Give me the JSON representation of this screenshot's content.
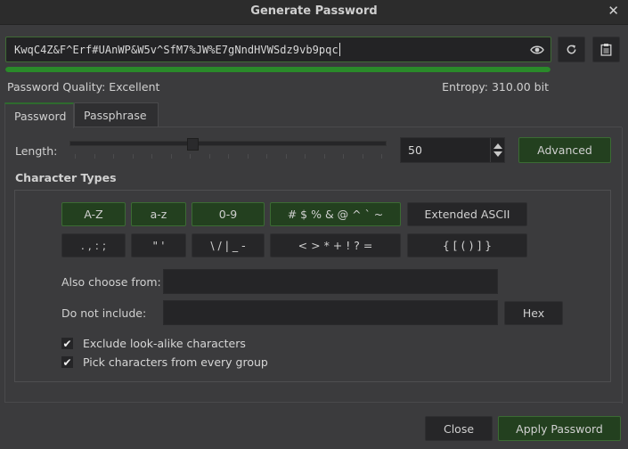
{
  "window": {
    "title": "Generate Password",
    "close_glyph": "✕"
  },
  "password": {
    "value": "KwqC4Z&F^Erf#UAnWP&W5v^SfM7%JW%E7gNndHVWSdz9vb9pqc",
    "visibility_icon": "eye-icon",
    "regenerate_icon": "refresh-icon",
    "copy_icon": "clipboard-icon",
    "quality_fill_fraction": 1.0,
    "quality_color": "#2a8a2a"
  },
  "status": {
    "quality": "Password Quality: Excellent",
    "entropy": "Entropy: 310.00 bit"
  },
  "tabs": [
    {
      "label": "Password",
      "active": true
    },
    {
      "label": "Passphrase",
      "active": false
    }
  ],
  "length": {
    "label": "Length:",
    "value": "50",
    "slider_fraction": 0.385,
    "advanced_label": "Advanced"
  },
  "character_types": {
    "title": "Character Types",
    "row1": [
      {
        "label": "A-Z",
        "checked": true
      },
      {
        "label": "a-z",
        "checked": true
      },
      {
        "label": "0-9",
        "checked": true
      },
      {
        "label": "# $ % & @ ^ ` ~",
        "checked": true
      },
      {
        "label": "Extended ASCII",
        "checked": false
      }
    ],
    "row2": [
      {
        "label": ". , : ;",
        "checked": false
      },
      {
        "label": "\" '",
        "checked": false
      },
      {
        "label": "\\ / | _ -",
        "checked": false
      },
      {
        "label": "< > * + ! ? =",
        "checked": false
      },
      {
        "label": "{ [ ( ) ] }",
        "checked": false
      }
    ],
    "also_choose_label": "Also choose from:",
    "also_choose_value": "",
    "do_not_include_label": "Do not include:",
    "do_not_include_value": "",
    "hex_label": "Hex",
    "options": [
      {
        "label": "Exclude look-alike characters",
        "checked": true
      },
      {
        "label": "Pick characters from every group",
        "checked": true
      }
    ],
    "check_glyph": "✔"
  },
  "footer": {
    "close_label": "Close",
    "apply_label": "Apply Password"
  }
}
